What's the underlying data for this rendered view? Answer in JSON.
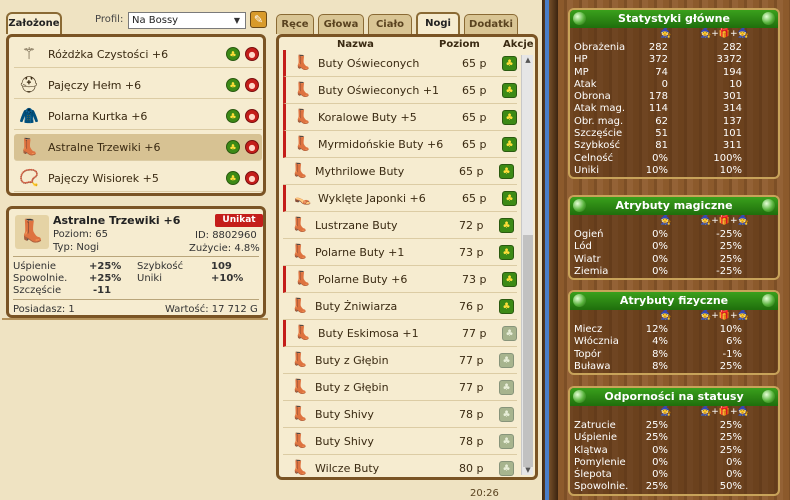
{
  "left": {
    "tab_label": "Założone",
    "profil_label": "Profil:",
    "profil_value": "Na Bossy",
    "equipped": [
      {
        "icon": "wand-icon",
        "glyph": "⚚",
        "name": "Różdżka Czystości +6"
      },
      {
        "icon": "helmet-icon",
        "glyph": "⛑",
        "name": "Pajęczy Hełm +6"
      },
      {
        "icon": "jacket-icon",
        "glyph": "🧥",
        "name": "Polarna Kurtka +6"
      },
      {
        "icon": "boots-icon",
        "glyph": "👢",
        "name": "Astralne Trzewiki +6"
      },
      {
        "icon": "amulet-icon",
        "glyph": "📿",
        "name": "Pajęczy Wisiorek +5"
      }
    ],
    "detail": {
      "name": "Astralne Trzewiki +6",
      "badge": "Unikat",
      "poziom": "Poziom: 65",
      "id": "ID: 8802960",
      "typ": "Typ: Nogi",
      "zuzycie": "Zużycie: 4.8%",
      "stats": [
        {
          "k": "Uśpienie",
          "v": "+25%",
          "k2": "Szybkość",
          "v2": "109"
        },
        {
          "k": "Spowolnie.",
          "v": "+25%",
          "k2": "Uniki",
          "v2": "+10%"
        },
        {
          "k": "Szczęście",
          "v": "-11",
          "k2": "",
          "v2": ""
        }
      ],
      "posiadasz": "Posiadasz: 1",
      "wartosc": "Wartość: 17 712 G"
    }
  },
  "middle": {
    "tabs": [
      "Ręce",
      "Głowa",
      "Ciało",
      "Nogi",
      "Dodatki"
    ],
    "active_tab": "Nogi",
    "col_nazwa": "Nazwa",
    "col_poziom": "Poziom",
    "col_akcje": "Akcje",
    "items": [
      {
        "name": "Buty Oświeconych",
        "lvl": "65 p",
        "glyph": "👢",
        "color": "#c94a1d",
        "low": true,
        "active": true
      },
      {
        "name": "Buty Oświeconych +1",
        "lvl": "65 p",
        "glyph": "👢",
        "color": "#c94a1d",
        "low": true,
        "active": true
      },
      {
        "name": "Koralowe Buty +5",
        "lvl": "65 p",
        "glyph": "👢",
        "color": "#d4261a",
        "low": true,
        "active": true
      },
      {
        "name": "Myrmidońskie Buty +6",
        "lvl": "65 p",
        "glyph": "👢",
        "color": "#3a2a2a",
        "low": true,
        "active": true
      },
      {
        "name": "Mythrilowe Buty",
        "lvl": "65 p",
        "glyph": "👢",
        "color": "#7b7b7b",
        "low": false,
        "active": true
      },
      {
        "name": "Wyklęte Japonki +6",
        "lvl": "65 p",
        "glyph": "👡",
        "color": "#5a2a2a",
        "low": true,
        "active": true
      },
      {
        "name": "Lustrzane Buty",
        "lvl": "72 p",
        "glyph": "👢",
        "color": "#8a8a8a",
        "low": false,
        "active": true
      },
      {
        "name": "Polarne Buty +1",
        "lvl": "73 p",
        "glyph": "👢",
        "color": "#9a9a9a",
        "low": false,
        "active": true
      },
      {
        "name": "Polarne Buty +6",
        "lvl": "73 p",
        "glyph": "👢",
        "color": "#9a9a9a",
        "low": true,
        "active": true
      },
      {
        "name": "Buty Żniwiarza",
        "lvl": "76 p",
        "glyph": "👢",
        "color": "#9a5a3a",
        "low": false,
        "active": true
      },
      {
        "name": "Buty Eskimosa +1",
        "lvl": "77 p",
        "glyph": "👢",
        "color": "#a07a5a",
        "low": true,
        "active": false
      },
      {
        "name": "Buty z Głębin",
        "lvl": "77 p",
        "glyph": "👢",
        "color": "#2a9ab0",
        "low": false,
        "active": false
      },
      {
        "name": "Buty z Głębin",
        "lvl": "77 p",
        "glyph": "👢",
        "color": "#2a9ab0",
        "low": false,
        "active": false
      },
      {
        "name": "Buty Shivy",
        "lvl": "78 p",
        "glyph": "👢",
        "color": "#6a4a8a",
        "low": false,
        "active": false
      },
      {
        "name": "Buty Shivy",
        "lvl": "78 p",
        "glyph": "👢",
        "color": "#6a4a8a",
        "low": false,
        "active": false
      },
      {
        "name": "Wilcze Buty",
        "lvl": "80 p",
        "glyph": "👢",
        "color": "#7a6a5a",
        "low": false,
        "active": false
      }
    ]
  },
  "right": {
    "boxes": [
      {
        "title": "Statystyki główne",
        "rows": [
          [
            "Obrażenia",
            "282",
            "282"
          ],
          [
            "HP",
            "372",
            "3372"
          ],
          [
            "MP",
            "74",
            "194"
          ],
          [
            "Atak",
            "0",
            "10"
          ],
          [
            "Obrona",
            "178",
            "301"
          ],
          [
            "Atak mag.",
            "114",
            "314"
          ],
          [
            "Obr. mag.",
            "62",
            "137"
          ],
          [
            "Szczęście",
            "51",
            "101"
          ],
          [
            "Szybkość",
            "81",
            "311"
          ],
          [
            "Celność",
            "0%",
            "100%"
          ],
          [
            "Uniki",
            "10%",
            "10%"
          ]
        ]
      },
      {
        "title": "Atrybuty magiczne",
        "rows": [
          [
            "Ogień",
            "0%",
            "-25%"
          ],
          [
            "Lód",
            "0%",
            "25%"
          ],
          [
            "Wiatr",
            "0%",
            "25%"
          ],
          [
            "Ziemia",
            "0%",
            "-25%"
          ]
        ]
      },
      {
        "title": "Atrybuty fizyczne",
        "rows": [
          [
            "Miecz",
            "12%",
            "10%"
          ],
          [
            "Włócznia",
            "4%",
            "6%"
          ],
          [
            "Topór",
            "8%",
            "-1%"
          ],
          [
            "Buława",
            "8%",
            "25%"
          ]
        ]
      },
      {
        "title": "Odporności na statusy",
        "rows": [
          [
            "Zatrucie",
            "25%",
            "25%"
          ],
          [
            "Uśpienie",
            "25%",
            "25%"
          ],
          [
            "Klątwa",
            "0%",
            "25%"
          ],
          [
            "Pomylenie",
            "0%",
            "0%"
          ],
          [
            "Ślepota",
            "0%",
            "0%"
          ],
          [
            "Spowolnie.",
            "25%",
            "50%"
          ]
        ]
      }
    ]
  },
  "clock": "20:26"
}
